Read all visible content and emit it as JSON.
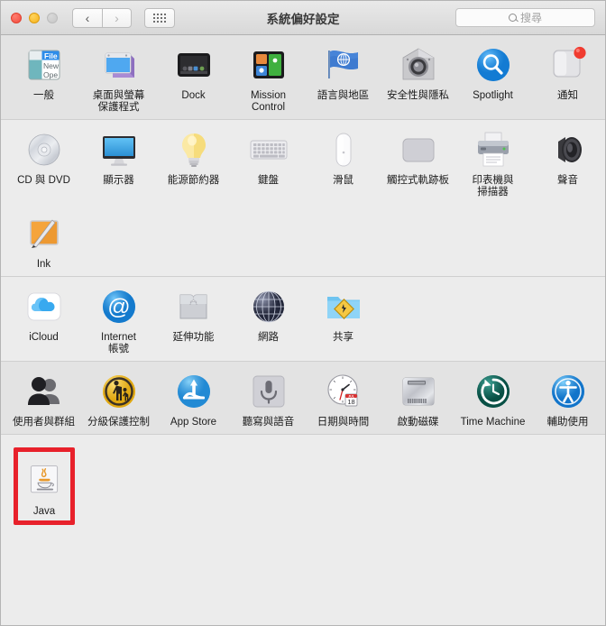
{
  "window": {
    "title": "系統偏好設定",
    "traffic_lights": [
      "close",
      "minimize",
      "zoom"
    ],
    "nav": {
      "back": "‹",
      "forward": "›"
    },
    "grid_button": "show-all-grid"
  },
  "search": {
    "placeholder": "搜尋",
    "value": "",
    "icon": "search-icon"
  },
  "colors": {
    "highlight": "#e8212b",
    "titlebar_top": "#e9e9e9",
    "titlebar_bottom": "#d8d8d8",
    "band_dark": "#e3e3e3",
    "band_light": "#ececec",
    "separator": "#cfcfcf",
    "label_text": "#1c1c1c"
  },
  "groups": [
    {
      "name": "personal",
      "shade": "dark",
      "items": [
        {
          "label": "一般",
          "icon": "general-icon"
        },
        {
          "label": "桌面與螢幕\n保護程式",
          "icon": "desktop-screensaver-icon"
        },
        {
          "label": "Dock",
          "icon": "dock-icon"
        },
        {
          "label": "Mission\nControl",
          "icon": "mission-control-icon"
        },
        {
          "label": "語言與地區",
          "icon": "language-region-icon"
        },
        {
          "label": "安全性與隱私",
          "icon": "security-privacy-icon"
        },
        {
          "label": "Spotlight",
          "icon": "spotlight-icon"
        },
        {
          "label": "通知",
          "icon": "notifications-icon"
        }
      ]
    },
    {
      "name": "hardware",
      "shade": "light",
      "items": [
        {
          "label": "CD 與 DVD",
          "icon": "cd-dvd-icon"
        },
        {
          "label": "顯示器",
          "icon": "displays-icon"
        },
        {
          "label": "能源節約器",
          "icon": "energy-saver-icon"
        },
        {
          "label": "鍵盤",
          "icon": "keyboard-icon"
        },
        {
          "label": "滑鼠",
          "icon": "mouse-icon"
        },
        {
          "label": "觸控式軌跡板",
          "icon": "trackpad-icon"
        },
        {
          "label": "印表機與\n掃描器",
          "icon": "printers-scanners-icon"
        },
        {
          "label": "聲音",
          "icon": "sound-icon"
        },
        {
          "label": "Ink",
          "icon": "ink-icon"
        }
      ]
    },
    {
      "name": "internet-wireless",
      "shade": "light",
      "items": [
        {
          "label": "iCloud",
          "icon": "icloud-icon"
        },
        {
          "label": "Internet\n帳號",
          "icon": "internet-accounts-icon"
        },
        {
          "label": "延伸功能",
          "icon": "extensions-icon"
        },
        {
          "label": "網路",
          "icon": "network-icon"
        },
        {
          "label": "共享",
          "icon": "sharing-icon"
        }
      ]
    },
    {
      "name": "system",
      "shade": "dark",
      "items": [
        {
          "label": "使用者與群組",
          "icon": "users-groups-icon"
        },
        {
          "label": "分級保護控制",
          "icon": "parental-controls-icon"
        },
        {
          "label": "App Store",
          "icon": "app-store-icon"
        },
        {
          "label": "聽寫與語音",
          "icon": "dictation-speech-icon"
        },
        {
          "label": "日期與時間",
          "icon": "date-time-icon"
        },
        {
          "label": "啟動磁碟",
          "icon": "startup-disk-icon"
        },
        {
          "label": "Time Machine",
          "icon": "time-machine-icon"
        },
        {
          "label": "輔助使用",
          "icon": "accessibility-icon"
        }
      ]
    },
    {
      "name": "other",
      "shade": "light",
      "highlighted": true,
      "items": [
        {
          "label": "Java",
          "icon": "java-icon"
        }
      ]
    }
  ]
}
